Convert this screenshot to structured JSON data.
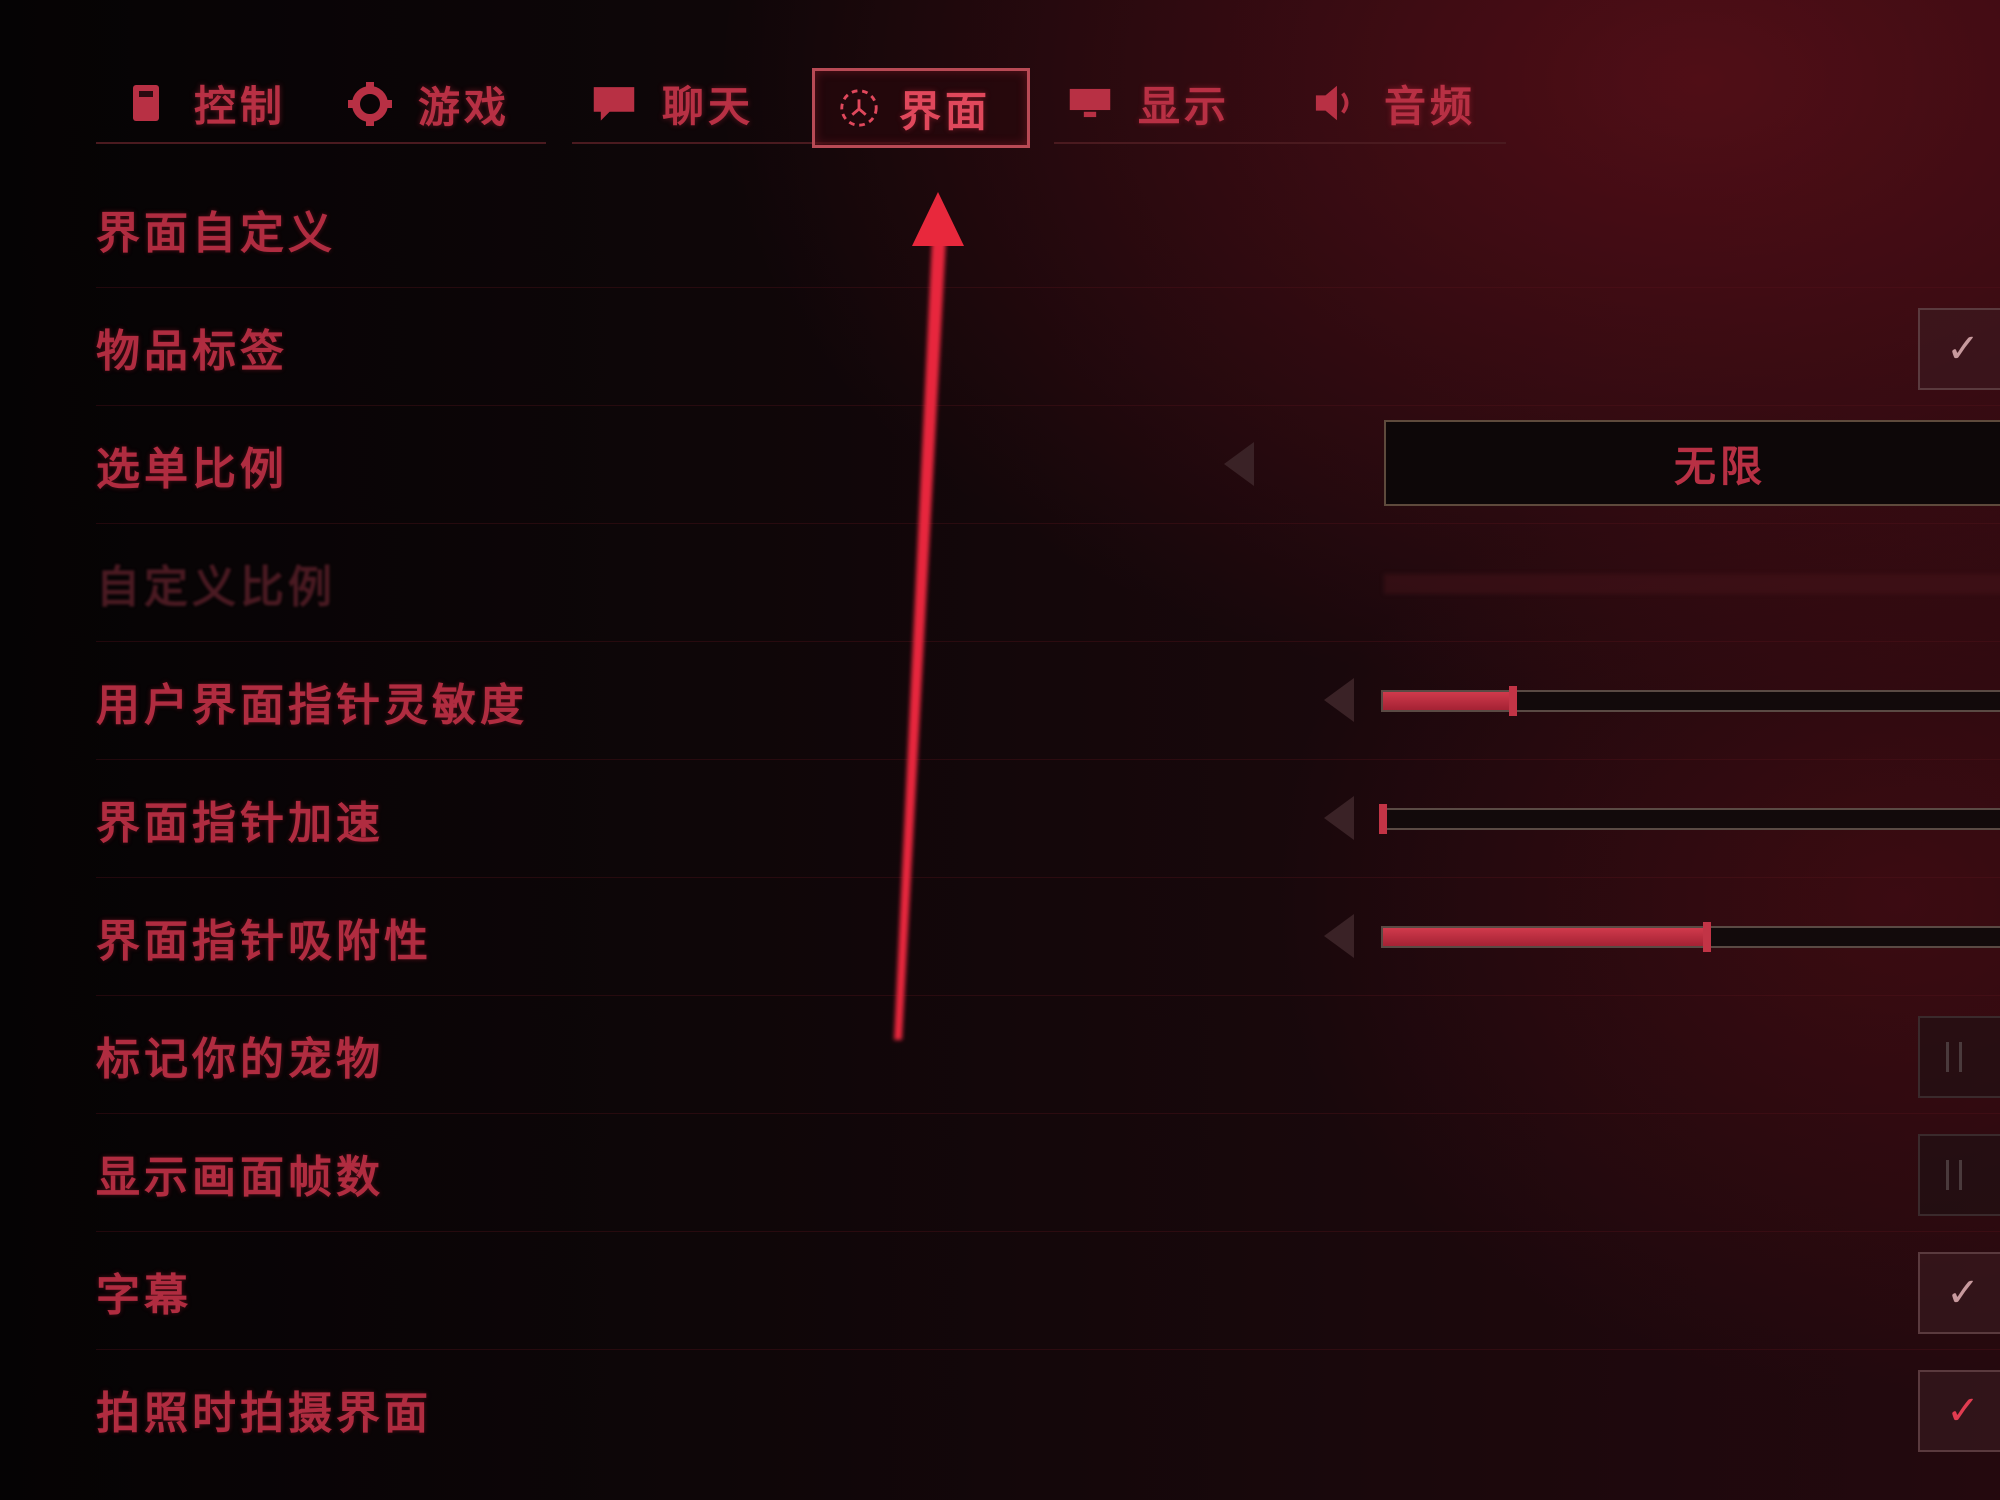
{
  "tabs": [
    {
      "id": "control",
      "label": "控制",
      "icon": "controller-icon",
      "active": false
    },
    {
      "id": "game",
      "label": "游戏",
      "icon": "gear-icon",
      "active": false
    },
    {
      "id": "chat",
      "label": "聊天",
      "icon": "chat-bubble-icon",
      "active": false
    },
    {
      "id": "interface",
      "label": "界面",
      "icon": "interface-icon",
      "active": true
    },
    {
      "id": "display",
      "label": "显示",
      "icon": "monitor-icon",
      "active": false
    },
    {
      "id": "audio",
      "label": "音频",
      "icon": "speaker-icon",
      "active": false
    }
  ],
  "settings": [
    {
      "id": "ui-customize",
      "label": "界面自定义",
      "control": "none"
    },
    {
      "id": "item-labels",
      "label": "物品标签",
      "control": "checkbox",
      "checked": true
    },
    {
      "id": "menu-scale",
      "label": "选单比例",
      "control": "selector",
      "value": "无限"
    },
    {
      "id": "custom-scale",
      "label": "自定义比例",
      "control": "none",
      "disabled": true
    },
    {
      "id": "ui-pointer-sensitivity",
      "label": "用户界面指针灵敏度",
      "control": "slider",
      "level": 0.2
    },
    {
      "id": "ui-pointer-acceleration",
      "label": "界面指针加速",
      "control": "slider",
      "level": 0.0
    },
    {
      "id": "ui-pointer-snap",
      "label": "界面指针吸附性",
      "control": "slider",
      "level": 0.5
    },
    {
      "id": "mark-pets",
      "label": "标记你的宠物",
      "control": "toggle",
      "checked": false
    },
    {
      "id": "show-fps",
      "label": "显示画面帧数",
      "control": "toggle",
      "checked": false
    },
    {
      "id": "subtitles",
      "label": "字幕",
      "control": "checkbox",
      "checked": true
    },
    {
      "id": "photo-hide-ui",
      "label": "拍照时拍摄界面",
      "control": "checkbox",
      "checked": true,
      "accent": true
    }
  ],
  "colors": {
    "accent": "#e0485c",
    "text": "#b02c40",
    "background": "#0a0506",
    "annotation_arrow": "#e8283c"
  }
}
